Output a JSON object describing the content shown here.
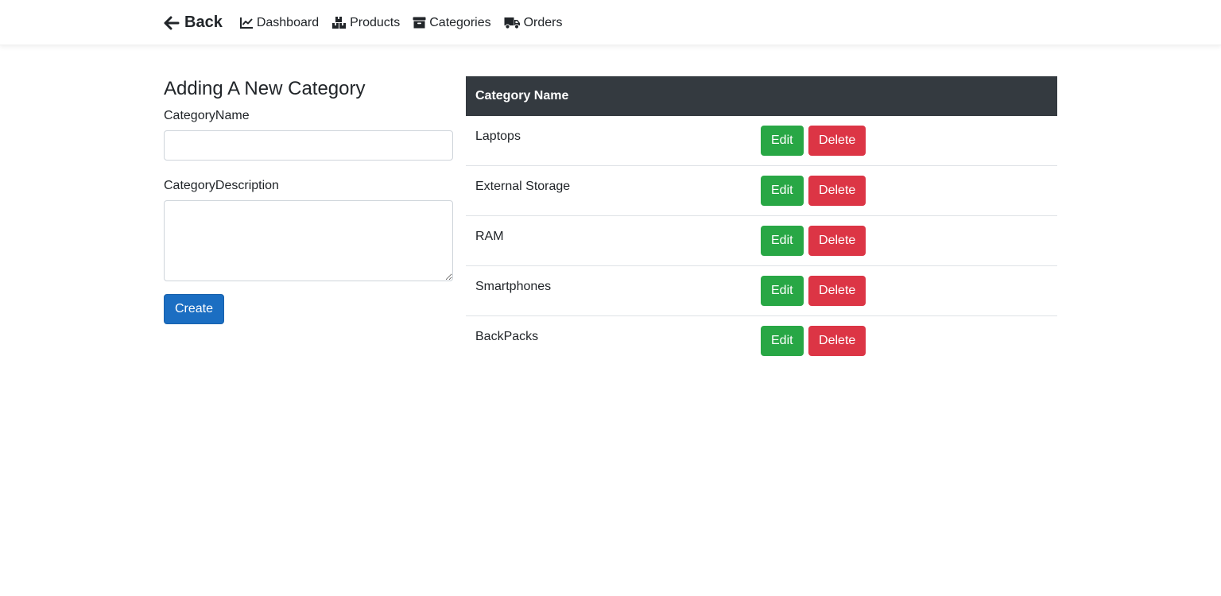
{
  "nav": {
    "back_label": "Back",
    "items": [
      {
        "label": "Dashboard",
        "icon": "chart-line-icon"
      },
      {
        "label": "Products",
        "icon": "boxes-icon"
      },
      {
        "label": "Categories",
        "icon": "archive-icon"
      },
      {
        "label": "Orders",
        "icon": "shipping-truck-icon"
      }
    ]
  },
  "form": {
    "title": "Adding A New Category",
    "name_label": "CategoryName",
    "name_value": "",
    "description_label": "CategoryDescription",
    "description_value": "",
    "create_label": "Create"
  },
  "table": {
    "header": "Category Name",
    "edit_label": "Edit",
    "delete_label": "Delete",
    "rows": [
      {
        "name": "Laptops"
      },
      {
        "name": "External Storage"
      },
      {
        "name": "RAM"
      },
      {
        "name": "Smartphones"
      },
      {
        "name": "BackPacks"
      }
    ]
  },
  "colors": {
    "header_bg": "#343a40",
    "create_button": "#1b6ec2",
    "edit_button": "#28a745",
    "delete_button": "#dc3545"
  }
}
